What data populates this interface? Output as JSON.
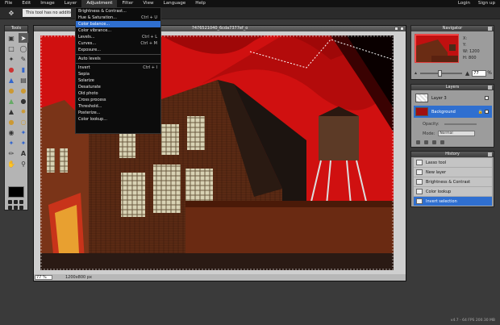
{
  "menubar": {
    "items": [
      "File",
      "Edit",
      "Image",
      "Layer",
      "Adjustment",
      "Filter",
      "View",
      "Language",
      "Help"
    ],
    "active": "Adjustment",
    "login": "Login",
    "signup": "Sign up"
  },
  "options": {
    "message": "This tool has no additional"
  },
  "tools_panel": {
    "title": "Tools"
  },
  "canvas": {
    "title": "7476521040_6cda7377ef_o",
    "zoom": "77",
    "zoom_unit": "%",
    "dimensions": "1200x800 px"
  },
  "adjustment_menu": {
    "items": [
      {
        "label": "Brightness & Contrast...",
        "shortcut": ""
      },
      {
        "label": "Hue & Saturation...",
        "shortcut": "Ctrl + U"
      },
      {
        "label": "Color balance...",
        "shortcut": "",
        "highlighted": true
      },
      {
        "label": "Color vibrance...",
        "shortcut": ""
      },
      {
        "label": "Levels...",
        "shortcut": "Ctrl + L"
      },
      {
        "label": "Curves...",
        "shortcut": "Ctrl + M"
      },
      {
        "label": "Exposure...",
        "shortcut": ""
      },
      {
        "separator": true
      },
      {
        "label": "Auto levels",
        "shortcut": ""
      },
      {
        "separator": true
      },
      {
        "label": "Invert",
        "shortcut": "Ctrl + I"
      },
      {
        "label": "Sepia",
        "shortcut": ""
      },
      {
        "label": "Solarize",
        "shortcut": ""
      },
      {
        "label": "Desaturate",
        "shortcut": ""
      },
      {
        "label": "Old photo",
        "shortcut": ""
      },
      {
        "label": "Cross process",
        "shortcut": ""
      },
      {
        "label": "Threshold...",
        "shortcut": ""
      },
      {
        "label": "Posterize...",
        "shortcut": ""
      },
      {
        "label": "Color lookup...",
        "shortcut": ""
      }
    ]
  },
  "navigator": {
    "title": "Navigator",
    "x_label": "X:",
    "y_label": "Y:",
    "w_label": "W:",
    "w_value": "1200",
    "h_label": "H:",
    "h_value": "800",
    "zoom": "77",
    "zoom_unit": "%"
  },
  "layers": {
    "title": "Layers",
    "items": [
      {
        "name": "Layer 3"
      },
      {
        "name": "Background",
        "selected": true
      }
    ],
    "opacity_label": "Opacity:",
    "mode_label": "Mode:",
    "mode_value": "Normal"
  },
  "history": {
    "title": "History",
    "items": [
      {
        "label": "Lasso tool"
      },
      {
        "label": "New layer"
      },
      {
        "label": "Brightness & Contrast"
      },
      {
        "label": "Color lookup"
      },
      {
        "label": "Invert selection",
        "selected": true
      }
    ]
  },
  "footer": {
    "status": "v4.7 - 64 FPS 200.30 MB"
  },
  "colors": {
    "accent": "#2f6fd0",
    "menubar": "#111111",
    "canvas_sky": "#cc1111"
  }
}
